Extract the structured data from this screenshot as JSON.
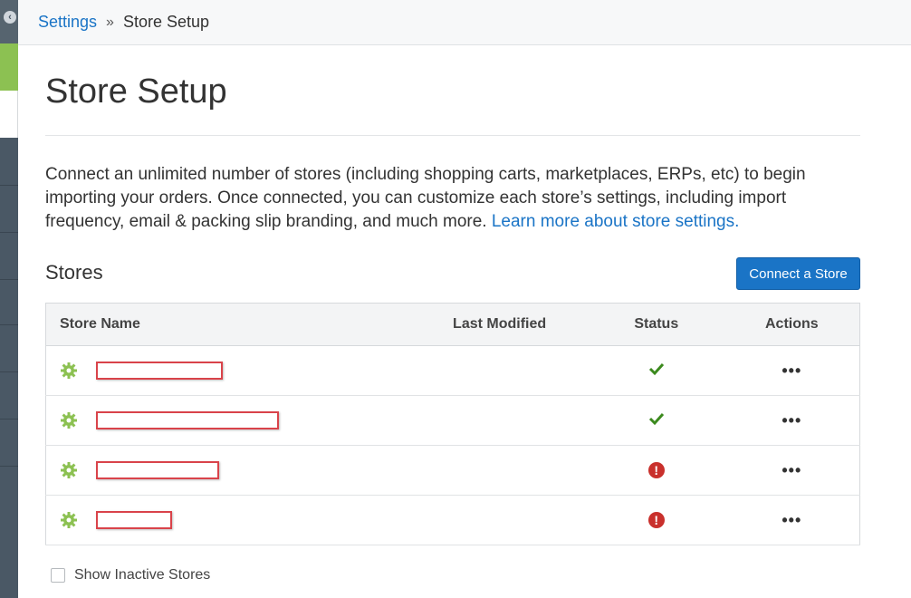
{
  "breadcrumb": {
    "parent": "Settings",
    "separator": "»",
    "current": "Store Setup"
  },
  "page": {
    "title": "Store Setup"
  },
  "intro": {
    "text": "Connect an unlimited number of stores (including shopping carts, marketplaces, ERPs, etc) to begin importing your orders. Once connected, you can customize each store’s settings, including import frequency, email & packing slip branding, and much more.",
    "link_text": "Learn more about store settings."
  },
  "stores_section": {
    "heading": "Stores",
    "connect_label": "Connect a Store"
  },
  "table": {
    "headers": {
      "name": "Store Name",
      "modified": "Last Modified",
      "status": "Status",
      "actions": "Actions"
    },
    "rows": [
      {
        "status": "ok",
        "actions": "•••"
      },
      {
        "status": "ok",
        "actions": "•••"
      },
      {
        "status": "error",
        "error_glyph": "!",
        "actions": "•••"
      },
      {
        "status": "error",
        "error_glyph": "!",
        "actions": "•••"
      }
    ]
  },
  "inactive_toggle": {
    "label": "Show Inactive Stores"
  },
  "colors": {
    "accent": "#1a74c6",
    "ok": "#3c8a1e",
    "error": "#c9302c",
    "gear": "#8cc152",
    "redaction": "#d9434a"
  },
  "icons": {
    "sidebar_toggle": "chevron-left-icon",
    "row": "gear-icon",
    "ok": "check-icon",
    "error": "alert-icon",
    "actions": "more-horizontal-icon"
  }
}
